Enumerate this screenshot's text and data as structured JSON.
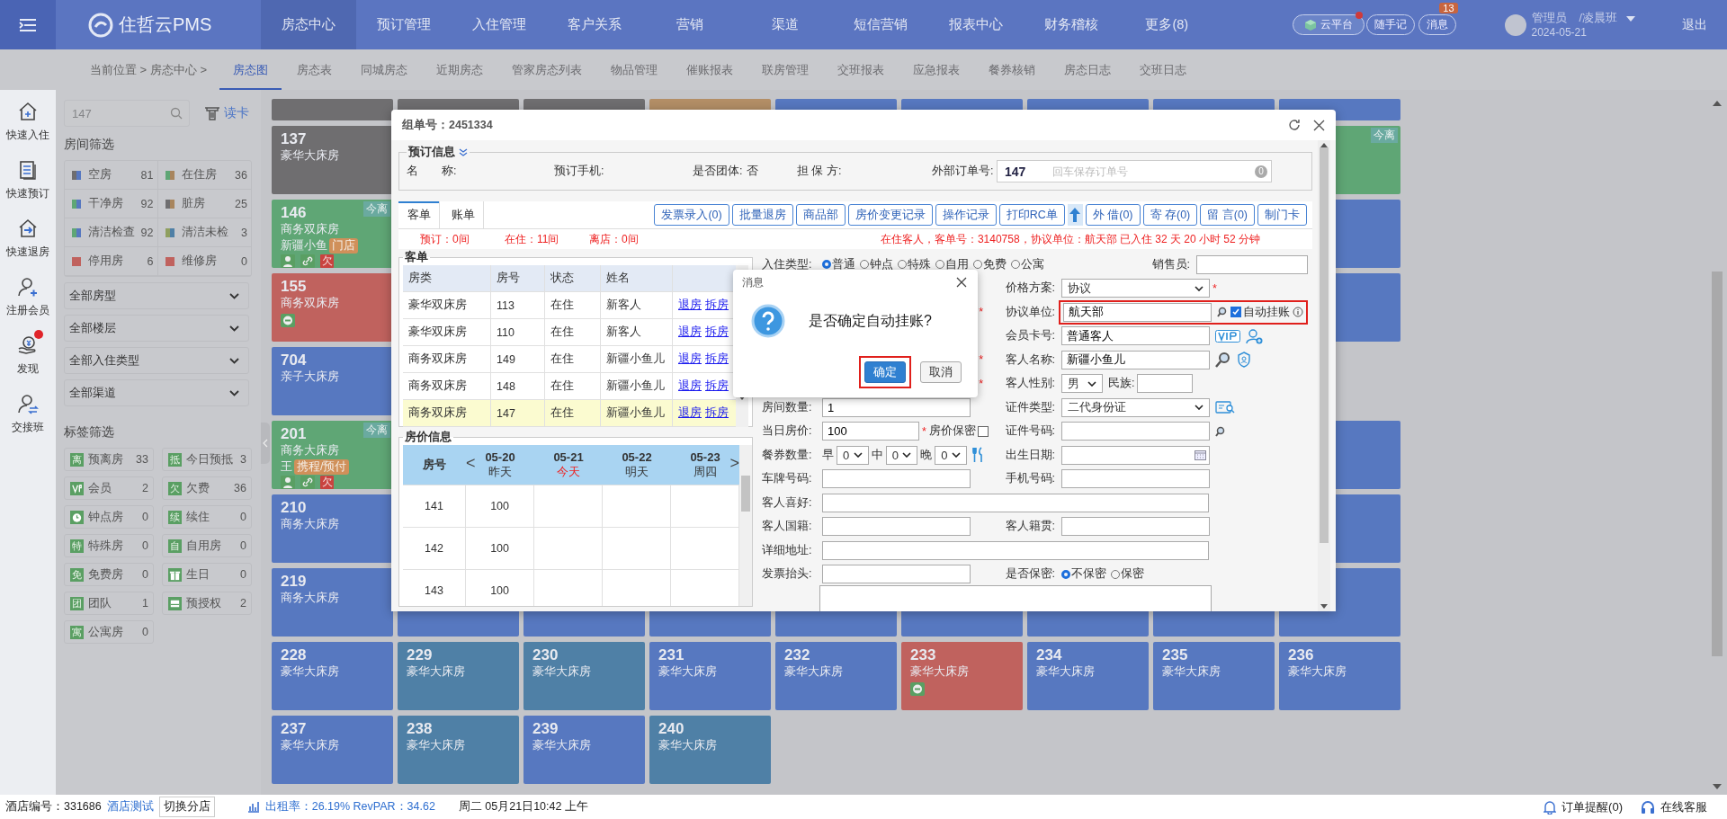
{
  "topbar": {
    "logo": "住哲云PMS",
    "nav": [
      {
        "label": "房态中心",
        "selected": true
      },
      {
        "label": "预订管理",
        "selected": false
      },
      {
        "label": "入住管理",
        "selected": false
      },
      {
        "label": "客户关系",
        "selected": false
      },
      {
        "label": "营销",
        "selected": false
      },
      {
        "label": "渠道",
        "selected": false
      },
      {
        "label": "短信营销",
        "selected": false
      },
      {
        "label": "报表中心",
        "selected": false
      },
      {
        "label": "财务稽核",
        "selected": false
      },
      {
        "label": "更多(8)",
        "selected": false
      }
    ],
    "cloud": "云平台",
    "notes": "随手记",
    "messages": "消息",
    "message_count": "13",
    "user": "管理员",
    "shift": "/凌晨班",
    "date": "2024-05-21",
    "logout": "退出"
  },
  "subnav": {
    "breadcrumb": "当前位置 > 房态中心 >",
    "tabs": [
      {
        "label": "房态图",
        "selected": true
      },
      {
        "label": "房态表",
        "selected": false
      },
      {
        "label": "同城房态",
        "selected": false
      },
      {
        "label": "近期房态",
        "selected": false
      },
      {
        "label": "管家房态列表",
        "selected": false
      },
      {
        "label": "物品管理",
        "selected": false
      },
      {
        "label": "催账报表",
        "selected": false
      },
      {
        "label": "联房管理",
        "selected": false
      },
      {
        "label": "交班报表",
        "selected": false
      },
      {
        "label": "应急报表",
        "selected": false
      },
      {
        "label": "餐券核销",
        "selected": false
      },
      {
        "label": "房态日志",
        "selected": false
      },
      {
        "label": "交班日志",
        "selected": false
      }
    ]
  },
  "rail": [
    {
      "kind": "checkin",
      "label": "快速入住",
      "dot": false
    },
    {
      "kind": "booking",
      "label": "快速预订",
      "dot": false
    },
    {
      "kind": "checkout",
      "label": "快速退房",
      "dot": false
    },
    {
      "kind": "member",
      "label": "注册会员",
      "dot": false
    },
    {
      "kind": "discover",
      "label": "发现",
      "dot": true
    },
    {
      "kind": "shift",
      "label": "交接班",
      "dot": false
    }
  ],
  "filter": {
    "search_placeholder": "147",
    "read_card": "读卡",
    "room_heading": "房间筛选",
    "room_filters": [
      {
        "label": "空房",
        "count": "81",
        "swatch": [
          {
            "color": "#6f6e70"
          },
          {
            "color": "#5778c0"
          }
        ]
      },
      {
        "label": "在住房",
        "count": "36",
        "swatch": [
          {
            "color": "#5fa675"
          },
          {
            "color": "#a8855d"
          }
        ]
      },
      {
        "label": "干净房",
        "count": "92",
        "swatch": [
          {
            "color": "#5fa675"
          },
          {
            "color": "#5778c0"
          }
        ]
      },
      {
        "label": "脏房",
        "count": "25",
        "swatch": [
          {
            "color": "#6f6e70"
          },
          {
            "color": "#a8855d"
          }
        ]
      },
      {
        "label": "清洁检查",
        "count": "92",
        "swatch": [
          {
            "color": "#5fa675"
          },
          {
            "color": "#5778c0"
          }
        ]
      },
      {
        "label": "清洁未检",
        "count": "3",
        "swatch": [
          {
            "color": "#8f9f5f"
          },
          {
            "color": "#4f80a6"
          }
        ]
      },
      {
        "label": "停用房",
        "count": "6",
        "swatch": [
          {
            "color": "#c0625e"
          },
          {
            "color": "#c0625e"
          }
        ]
      },
      {
        "label": "维修房",
        "count": "0",
        "swatch": [
          {
            "color": "#c0625e"
          },
          {
            "color": "#c0625e"
          }
        ]
      }
    ],
    "dropdowns": [
      "全部房型",
      "全部楼层",
      "全部入住类型",
      "全部渠道"
    ],
    "tag_heading": "标签筛选",
    "tags": [
      {
        "kind": "glyph",
        "glyph": "离",
        "label": "预离房",
        "count": "33"
      },
      {
        "kind": "glyph",
        "glyph": "抵",
        "label": "今日预抵",
        "count": "3"
      },
      {
        "kind": "vip",
        "label": "会员",
        "count": "2"
      },
      {
        "kind": "glyph",
        "glyph": "欠",
        "label": "欠费",
        "count": "36"
      },
      {
        "kind": "clock",
        "label": "钟点房",
        "count": "0"
      },
      {
        "kind": "glyph",
        "glyph": "续",
        "label": "续住",
        "count": "0"
      },
      {
        "kind": "glyph",
        "glyph": "特",
        "label": "特殊房",
        "count": "0"
      },
      {
        "kind": "glyph",
        "glyph": "自",
        "label": "自用房",
        "count": "0"
      },
      {
        "kind": "glyph",
        "glyph": "免",
        "label": "免费房",
        "count": "0"
      },
      {
        "kind": "gift",
        "label": "生日",
        "count": "0"
      },
      {
        "kind": "glyph",
        "glyph": "团",
        "label": "团队",
        "count": "1"
      },
      {
        "kind": "card",
        "label": "预授权",
        "count": "2"
      },
      {
        "kind": "glyph",
        "glyph": "寓",
        "label": "公寓房",
        "count": "0"
      }
    ]
  },
  "rooms": [
    {
      "kind": "partial",
      "cells": [
        {
          "color": "#6f6e70"
        },
        {
          "color": "#6f6e70"
        },
        {
          "color": "#6f6e70"
        },
        {
          "color": "#b38e66"
        },
        {
          "color": "#5778c0"
        },
        {
          "color": "#5778c0"
        },
        {
          "color": "#5778c0"
        },
        {
          "color": "#5778c0"
        },
        {
          "color": "#5778c0"
        }
      ]
    },
    {
      "kind": "full",
      "cells": [
        {
          "number": "137",
          "type": "豪华大床房",
          "color": "#6f6e70"
        },
        null,
        null,
        null,
        null,
        null,
        null,
        null,
        {
          "color": "#5fa675",
          "badge": "今离"
        }
      ]
    },
    {
      "kind": "full",
      "cells": [
        {
          "number": "146",
          "type": "商务双床房",
          "color": "#5fa675",
          "badge": "今离",
          "guest": "新疆小鱼",
          "tag": "门店",
          "flags": [
            {
              "kind": "person"
            },
            {
              "kind": "link"
            },
            {
              "kind": "owe",
              "text": "欠"
            }
          ]
        },
        null,
        null,
        null,
        null,
        null,
        null,
        null,
        {
          "color": "#5778c0"
        }
      ]
    },
    {
      "kind": "full",
      "cells": [
        {
          "number": "155",
          "type": "商务双床房",
          "color": "#c0625e",
          "blocked": true
        },
        null,
        null,
        null,
        null,
        null,
        null,
        null,
        {
          "color": "#5778c0"
        }
      ]
    },
    {
      "kind": "full",
      "cells": [
        {
          "number": "704",
          "type": "亲子大床房",
          "color": "#5778c0"
        },
        null,
        null,
        null,
        null,
        null,
        null,
        null,
        null
      ]
    },
    {
      "kind": "full",
      "cells": [
        {
          "number": "201",
          "type": "商务大床房",
          "color": "#5fa675",
          "badge": "今离",
          "guest": "王",
          "tag": "携程/预付",
          "flags": [
            {
              "kind": "person"
            },
            {
              "kind": "link"
            },
            {
              "kind": "owe",
              "text": "欠"
            }
          ]
        },
        null,
        null,
        null,
        null,
        null,
        null,
        null,
        {
          "color": "#5778c0"
        }
      ]
    },
    {
      "kind": "full",
      "cells": [
        {
          "number": "210",
          "type": "商务大床房",
          "color": "#5778c0"
        },
        null,
        null,
        null,
        null,
        null,
        null,
        null,
        {
          "color": "#5778c0"
        }
      ]
    },
    {
      "kind": "full",
      "cells": [
        {
          "number": "219",
          "type": "商务大床房",
          "color": "#5778c0"
        },
        {
          "color": "#5778c0"
        },
        {
          "color": "#5778c0"
        },
        {
          "color": "#5778c0"
        },
        {
          "color": "#5778c0"
        },
        {
          "color": "#5778c0"
        },
        {
          "color": "#5778c0"
        },
        {
          "color": "#5778c0"
        },
        {
          "color": "#5778c0"
        }
      ]
    },
    {
      "kind": "full",
      "cells": [
        {
          "number": "228",
          "type": "豪华大床房",
          "color": "#5778c0"
        },
        {
          "number": "229",
          "type": "豪华大床房",
          "color": "#4f80a6"
        },
        {
          "number": "230",
          "type": "豪华大床房",
          "color": "#4f80a6"
        },
        {
          "number": "231",
          "type": "豪华大床房",
          "color": "#5778c0"
        },
        {
          "number": "232",
          "type": "豪华大床房",
          "color": "#5778c0"
        },
        {
          "number": "233",
          "type": "豪华大床房",
          "color": "#c0625e",
          "blocked": true
        },
        {
          "number": "234",
          "type": "豪华大床房",
          "color": "#5778c0"
        },
        {
          "number": "235",
          "type": "豪华大床房",
          "color": "#5778c0"
        },
        {
          "number": "236",
          "type": "豪华大床房",
          "color": "#5778c0"
        }
      ]
    },
    {
      "kind": "full",
      "cells": [
        {
          "number": "237",
          "type": "豪华大床房",
          "color": "#5778c0"
        },
        {
          "number": "238",
          "type": "豪华大床房",
          "color": "#4f80a6"
        },
        {
          "number": "239",
          "type": "豪华大床房",
          "color": "#5778c0"
        },
        {
          "number": "240",
          "type": "豪华大床房",
          "color": "#4f80a6"
        }
      ]
    }
  ],
  "modal": {
    "title": "组单号：2451334",
    "booking": {
      "legend": "预订信息",
      "name": "名　　称:",
      "phone": "预订手机:",
      "group_label": "是否团体:",
      "group_value": "否",
      "guarantor": "担 保 方:",
      "ext_label": "外部订单号:",
      "ext_value": "147",
      "ext_placeholder": "回车保存订单号",
      "ext_count": "0"
    },
    "tabs": [
      {
        "label": "客单",
        "selected": true
      },
      {
        "label": "账单",
        "selected": false
      }
    ],
    "actions": [
      {
        "kind": "text",
        "label": "发票录入(0)"
      },
      {
        "kind": "text",
        "label": "批量退房"
      },
      {
        "kind": "text",
        "label": "商品部"
      },
      {
        "kind": "text",
        "label": "房价变更记录"
      },
      {
        "kind": "text",
        "label": "操作记录"
      },
      {
        "kind": "text",
        "label": "打印RC单"
      },
      {
        "kind": "arrow"
      },
      {
        "kind": "text",
        "label": "外 借(0)"
      },
      {
        "kind": "text",
        "label": "寄 存(0)"
      },
      {
        "kind": "text",
        "label": "留 言(0)"
      },
      {
        "kind": "text",
        "label": "制门卡"
      }
    ],
    "stats": [
      "预订：0间",
      "在住：11间",
      "离店：0间"
    ],
    "notice": "在住客人，客单号：3140758，协议单位：航天部 已入住 32 天 20 小时 52 分钟",
    "guests": {
      "legend": "客单",
      "columns": [
        "房类",
        "房号",
        "状态",
        "姓名"
      ],
      "rows": [
        {
          "cells": [
            "豪华双床房",
            "113",
            "在住",
            "新客人"
          ],
          "links": [
            "退房",
            "拆房"
          ],
          "selected": false
        },
        {
          "cells": [
            "豪华双床房",
            "110",
            "在住",
            "新客人"
          ],
          "links": [
            "退房",
            "拆房"
          ],
          "selected": false
        },
        {
          "cells": [
            "商务双床房",
            "149",
            "在住",
            "新疆小鱼儿"
          ],
          "links": [
            "退房",
            "拆房"
          ],
          "selected": false
        },
        {
          "cells": [
            "商务双床房",
            "148",
            "在住",
            "新疆小鱼儿"
          ],
          "links": [
            "退房",
            "拆房"
          ],
          "selected": false
        },
        {
          "cells": [
            "商务双床房",
            "147",
            "在住",
            "新疆小鱼儿"
          ],
          "links": [
            "退房",
            "拆房"
          ],
          "selected": true
        }
      ]
    },
    "rates": {
      "legend": "房价信息",
      "header": "房号",
      "prev": "<",
      "next": ">",
      "days": [
        {
          "date": "05-20",
          "label": "昨天",
          "today": false
        },
        {
          "date": "05-21",
          "label": "今天",
          "today": true
        },
        {
          "date": "05-22",
          "label": "明天",
          "today": false
        },
        {
          "date": "05-23",
          "label": "周四",
          "today": false
        }
      ],
      "rows": [
        {
          "room": "141",
          "price": "100"
        },
        {
          "room": "142",
          "price": "100"
        },
        {
          "room": "143",
          "price": "100"
        }
      ]
    },
    "form": [
      {
        "left": {
          "kind": "radios",
          "label": "入住类型:",
          "options": [
            {
              "label": "普通",
              "selected": true
            },
            {
              "label": "钟点",
              "selected": false
            },
            {
              "label": "特殊",
              "selected": false
            },
            {
              "label": "自用",
              "selected": false
            },
            {
              "label": "免费",
              "selected": false
            },
            {
              "label": "公寓",
              "selected": false
            }
          ]
        },
        "right": {
          "kind": "seller",
          "label": "销售员:"
        }
      },
      {
        "right": {
          "kind": "select",
          "label": "价格方案:",
          "value": "协议",
          "star": "*"
        }
      },
      {
        "left": {
          "kind": "star",
          "text": "*"
        },
        "right": {
          "kind": "unit",
          "label": "协议单位:",
          "value": "航天部",
          "checkbox": {
            "label": "自动挂账",
            "checked": true
          },
          "highlighted": true
        }
      },
      {
        "right": {
          "kind": "member",
          "label": "会员卡号:",
          "value": "普通客人"
        }
      },
      {
        "left": {
          "kind": "star",
          "text": "*"
        },
        "right": {
          "kind": "name",
          "label": "客人名称:",
          "value": "新疆小鱼儿"
        }
      },
      {
        "left": {
          "kind": "star",
          "text": "*"
        },
        "right": {
          "kind": "gender",
          "label": "客人性别:",
          "value": "男",
          "extra_label": "民族:"
        }
      },
      {
        "left": {
          "kind": "input",
          "label": "房间数量:",
          "value": "1"
        },
        "right": {
          "kind": "id_type",
          "label": "证件类型:",
          "value": "二代身份证"
        }
      },
      {
        "left": {
          "kind": "price",
          "label": "当日房价:",
          "value": "100",
          "star": "*",
          "checkbox": {
            "label": "房价保密",
            "checked": false
          }
        },
        "right": {
          "kind": "id_number",
          "label": "证件号码:"
        }
      },
      {
        "left": {
          "kind": "meals",
          "label": "餐券数量:",
          "meals": [
            {
              "prefix": "早",
              "value": "0"
            },
            {
              "prefix": "中",
              "value": "0"
            },
            {
              "prefix": "晚",
              "value": "0"
            }
          ]
        },
        "right": {
          "kind": "date",
          "label": "出生日期:"
        }
      },
      {
        "left": {
          "kind": "input",
          "label": "车牌号码:"
        },
        "right": {
          "kind": "input",
          "label": "手机号码:"
        }
      },
      {
        "wide": {
          "kind": "input",
          "label": "客人喜好:"
        }
      },
      {
        "left": {
          "kind": "input",
          "label": "客人国籍:"
        },
        "right": {
          "kind": "input",
          "label": "客人籍贯:"
        }
      },
      {
        "wide": {
          "kind": "input",
          "label": "详细地址:"
        }
      },
      {
        "left": {
          "kind": "input",
          "label": "发票抬头:"
        },
        "right": {
          "kind": "radios",
          "label": "是否保密:",
          "options": [
            {
              "label": "不保密",
              "selected": true
            },
            {
              "label": "保密",
              "selected": false
            }
          ]
        }
      },
      {
        "wide": {
          "kind": "textarea"
        }
      }
    ]
  },
  "dialog": {
    "title": "消息",
    "message": "是否确定自动挂账?",
    "buttons": [
      {
        "label": "确定",
        "kind": "primary",
        "highlighted": true
      },
      {
        "label": "取消",
        "kind": "default",
        "highlighted": false
      }
    ]
  },
  "footer": {
    "hotel_label": "酒店编号：331686",
    "hotel_name": "酒店测试",
    "switch": "切换分店",
    "stats": "出租率：26.19% RevPAR：34.62",
    "datetime": "周二 05月21日10:42 上午",
    "order_alert": "订单提醒(0)",
    "support": "在线客服"
  }
}
